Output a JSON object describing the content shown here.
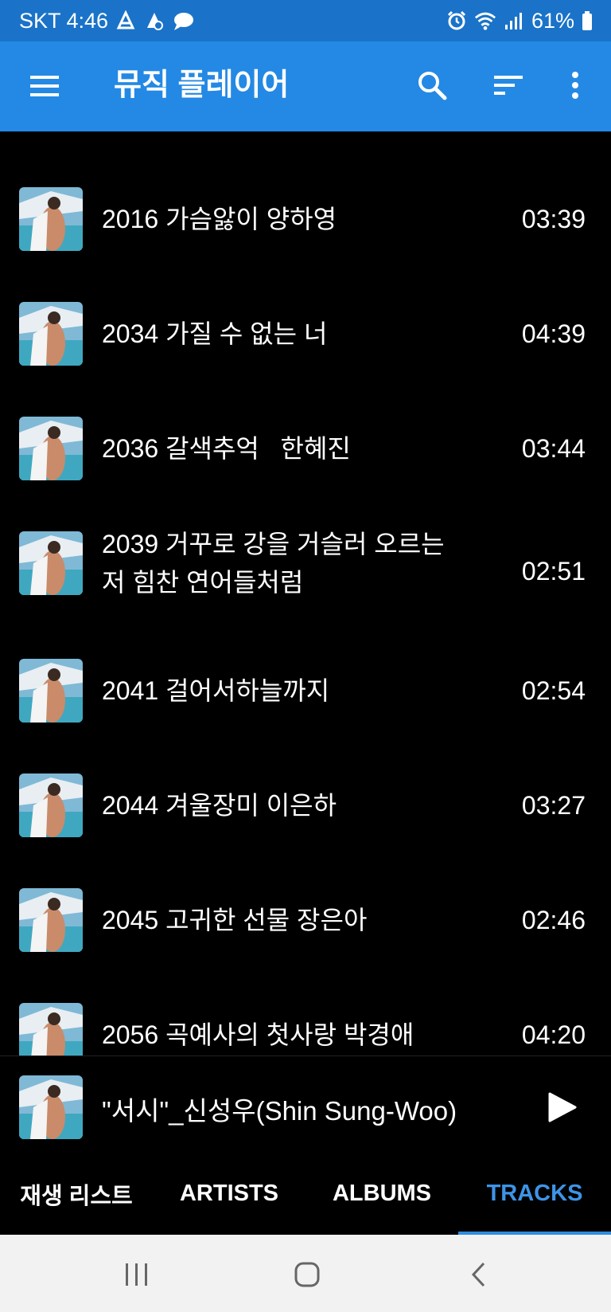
{
  "status_bar": {
    "carrier_time": "SKT 4:46",
    "battery": "61%"
  },
  "app_bar": {
    "title": "뮤직 플레이어"
  },
  "tracks": [
    {
      "title": "2016 가슴앓이 양하영",
      "duration": "03:39"
    },
    {
      "title": "2034 가질 수 없는 너",
      "duration": "04:39"
    },
    {
      "title": "2036 갈색추억   한혜진",
      "duration": "03:44"
    },
    {
      "title": "2039 거꾸로 강을 거슬러 오르는\n저 힘찬 연어들처럼",
      "duration": "02:51"
    },
    {
      "title": "2041 걸어서하늘까지",
      "duration": "02:54"
    },
    {
      "title": "2044 겨울장미 이은하",
      "duration": "03:27"
    },
    {
      "title": "2045 고귀한 선물 장은아",
      "duration": "02:46"
    },
    {
      "title": "2056 곡예사의 첫사랑 박경애",
      "duration": "04:20"
    }
  ],
  "now_playing": {
    "title": "\"서시\"_신성우(Shin Sung-Woo)"
  },
  "tabs": [
    {
      "label": "재생 리스트"
    },
    {
      "label": "ARTISTS"
    },
    {
      "label": "ALBUMS"
    },
    {
      "label": "TRACKS"
    }
  ],
  "colors": {
    "status_bar": "#1a73c8",
    "app_bar": "#2489e4",
    "accent": "#3d94e6",
    "background": "#000000",
    "nav_bar": "#f2f2f2"
  }
}
